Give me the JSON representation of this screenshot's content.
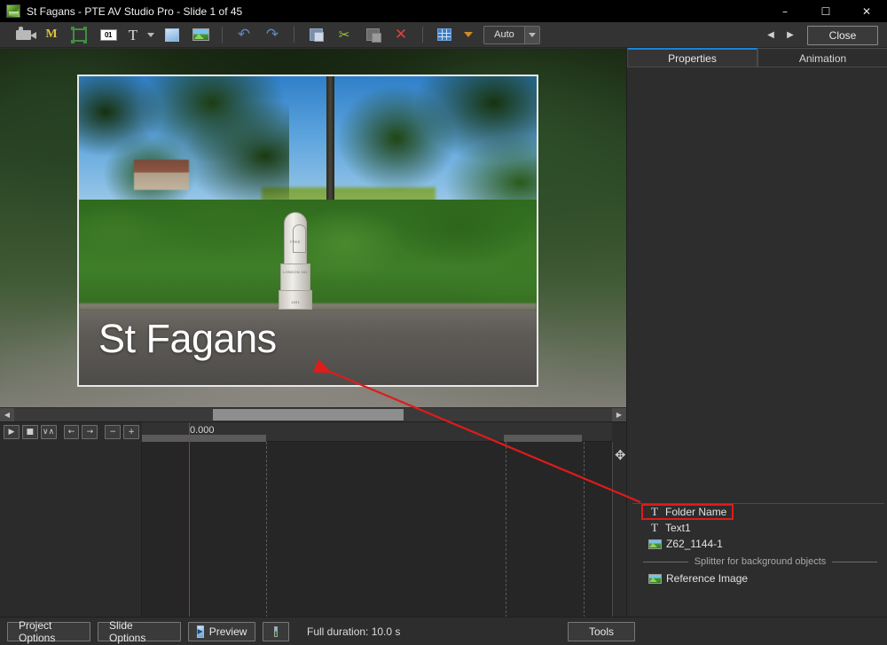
{
  "window": {
    "title": "St Fagans - PTE AV Studio Pro - Slide 1 of 45",
    "app_icon": "app-logo-icon",
    "minimize": "–",
    "maximize": "☐",
    "close": "✕"
  },
  "toolbar": {
    "items": [
      {
        "name": "video-camera-icon",
        "label": ""
      },
      {
        "name": "mask-m-icon",
        "label": "M"
      },
      {
        "name": "frame-corners-icon",
        "label": ""
      },
      {
        "name": "slide-number-icon",
        "label": "01"
      },
      {
        "name": "text-tool-icon",
        "label": "T"
      },
      {
        "name": "text-dropdown-caret-icon",
        "label": ""
      },
      {
        "name": "rectangle-tool-icon",
        "label": ""
      },
      {
        "name": "image-tool-icon",
        "label": ""
      },
      {
        "name": "undo-icon",
        "label": "↶"
      },
      {
        "name": "redo-icon",
        "label": "↷"
      },
      {
        "name": "copy-icon",
        "label": ""
      },
      {
        "name": "cut-scissors-icon",
        "label": "✂"
      },
      {
        "name": "paste-icon",
        "label": ""
      },
      {
        "name": "delete-x-icon",
        "label": "✕"
      },
      {
        "name": "grid-icon",
        "label": ""
      },
      {
        "name": "grid-dropdown-caret-icon",
        "label": ""
      }
    ],
    "zoom_combo": {
      "value": "Auto",
      "caret": "▼"
    },
    "nav_prev": "◀",
    "nav_next": "▶",
    "close_label": "Close"
  },
  "preview": {
    "overlay_text": "St Fagans",
    "milestone_lines": [
      "FREE",
      "LONDON 161",
      "1841"
    ]
  },
  "timeline": {
    "controls": [
      {
        "name": "play-button",
        "glyph": "▶"
      },
      {
        "name": "stop-button",
        "glyph": "■"
      },
      {
        "name": "waveform-button",
        "glyph": "∨∧"
      },
      {
        "name": "previous-button",
        "glyph": "←"
      },
      {
        "name": "next-button",
        "glyph": "→"
      },
      {
        "name": "zoom-out-button",
        "glyph": "−"
      },
      {
        "name": "zoom-in-button",
        "glyph": "+"
      }
    ],
    "current_time": "0.000",
    "move-tool": "✥"
  },
  "right_panel": {
    "tabs": [
      {
        "label": "Properties",
        "active": true
      },
      {
        "label": "Animation",
        "active": false
      }
    ],
    "objects": [
      {
        "label": "Folder Name",
        "icon": "text-object-icon",
        "selected": true
      },
      {
        "label": "Text1",
        "icon": "text-object-icon",
        "selected": false
      },
      {
        "label": "Z62_1144-1",
        "icon": "image-object-icon",
        "selected": false
      }
    ],
    "splitter_label": "Splitter for background objects",
    "background_objects": [
      {
        "label": "Reference Image",
        "icon": "image-object-icon"
      }
    ]
  },
  "bottom_bar": {
    "project_options": "Project Options",
    "slide_options": "Slide Options",
    "preview": "Preview",
    "fullscreen_icon": "fullscreen-preview-icon",
    "full_duration": "Full duration: 10.0 s",
    "tools": "Tools"
  },
  "colors": {
    "accent_blue": "#1a84d6",
    "annotation_red": "#e01b1b",
    "panel_bg": "#2d2d2d",
    "toolbar_bg": "#333333",
    "titlebar_bg": "#000000"
  }
}
